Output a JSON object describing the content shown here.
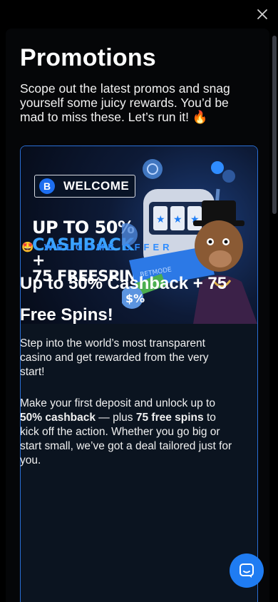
{
  "header": {
    "close_icon": "close-icon"
  },
  "page": {
    "title": "Promotions",
    "subtitle": "Scope out the latest promos and snag yourself some juicy rewards. You’d be mad to miss these. Let’s run it!",
    "subtitle_emoji": "🔥"
  },
  "promo_card": {
    "banner": {
      "badge_logo": "B",
      "badge_text": "WELCOME",
      "line1": "UP TO 50%",
      "line2": "CASHBACK",
      "line3": "+",
      "line4": "75 FREESPINS",
      "machine_text": "BETMODE"
    },
    "offer_emoji": "🤩",
    "offer_label": "WELCOME OFFER",
    "headline": "Up to 50% Cashback + 75 Free Spins!",
    "description": "Step into the world’s most transparent casino and get rewarded from the very start!",
    "details": {
      "part1": "Make your first deposit and unlock up to ",
      "bold1": "50% cashback",
      "part2": " — plus ",
      "bold2": "75 free spins",
      "part3": " to kick off the action. Whether you go big or start small, we’ve got a deal tailored just for you."
    }
  },
  "chat": {
    "icon": "chat-icon"
  },
  "colors": {
    "accent": "#2e8cff",
    "card_border": "#2a6fd6",
    "chat_button": "#1f7cf2"
  }
}
